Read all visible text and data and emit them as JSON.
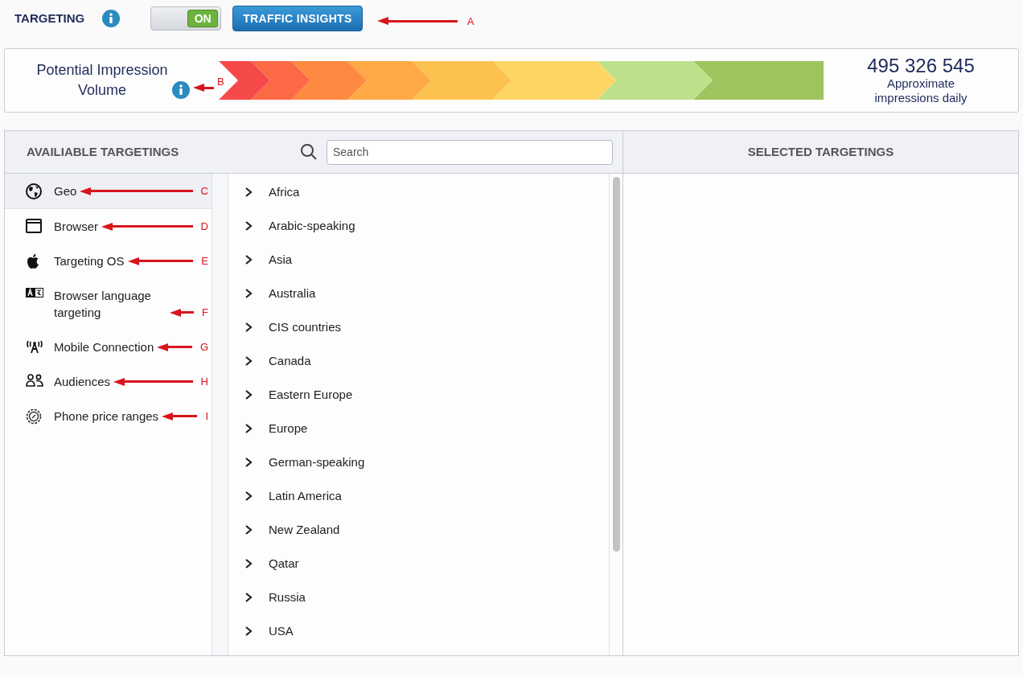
{
  "header": {
    "title": "TARGETING",
    "toggle": {
      "label": "ON",
      "on": true
    },
    "button": "TRAFFIC INSIGHTS",
    "annotation": "A"
  },
  "gauge": {
    "title": "Potential Impression Volume",
    "annotation": "B",
    "count": "495 326 545",
    "caption": "Approximate impressions daily"
  },
  "available": {
    "title": "AVAILIABLE TARGETINGS",
    "search": {
      "placeholder": "Search"
    }
  },
  "selected_panel": {
    "title": "SELECTED TARGETINGS"
  },
  "categories": [
    {
      "label": "Geo",
      "selected": true,
      "annotation": "C"
    },
    {
      "label": "Browser",
      "selected": false,
      "annotation": "D"
    },
    {
      "label": "Targeting OS",
      "selected": false,
      "annotation": "E"
    },
    {
      "label": "Browser language targeting",
      "selected": false,
      "annotation": "F"
    },
    {
      "label": "Mobile Connection",
      "selected": false,
      "annotation": "G"
    },
    {
      "label": "Audiences",
      "selected": false,
      "annotation": "H"
    },
    {
      "label": "Phone price ranges",
      "selected": false,
      "annotation": "I"
    }
  ],
  "regions": [
    {
      "label": "Africa",
      "expanded": false
    },
    {
      "label": "Arabic-speaking",
      "expanded": false
    },
    {
      "label": "Asia",
      "expanded": false
    },
    {
      "label": "Australia",
      "expanded": false
    },
    {
      "label": "CIS countries",
      "expanded": false
    },
    {
      "label": "Canada",
      "expanded": false
    },
    {
      "label": "Eastern Europe",
      "expanded": false
    },
    {
      "label": "Europe",
      "expanded": false
    },
    {
      "label": "German-speaking",
      "expanded": false
    },
    {
      "label": "Latin America",
      "expanded": false
    },
    {
      "label": "New Zealand",
      "expanded": false
    },
    {
      "label": "Qatar",
      "expanded": false
    },
    {
      "label": "Russia",
      "expanded": false
    },
    {
      "label": "USA",
      "expanded": false
    }
  ]
}
